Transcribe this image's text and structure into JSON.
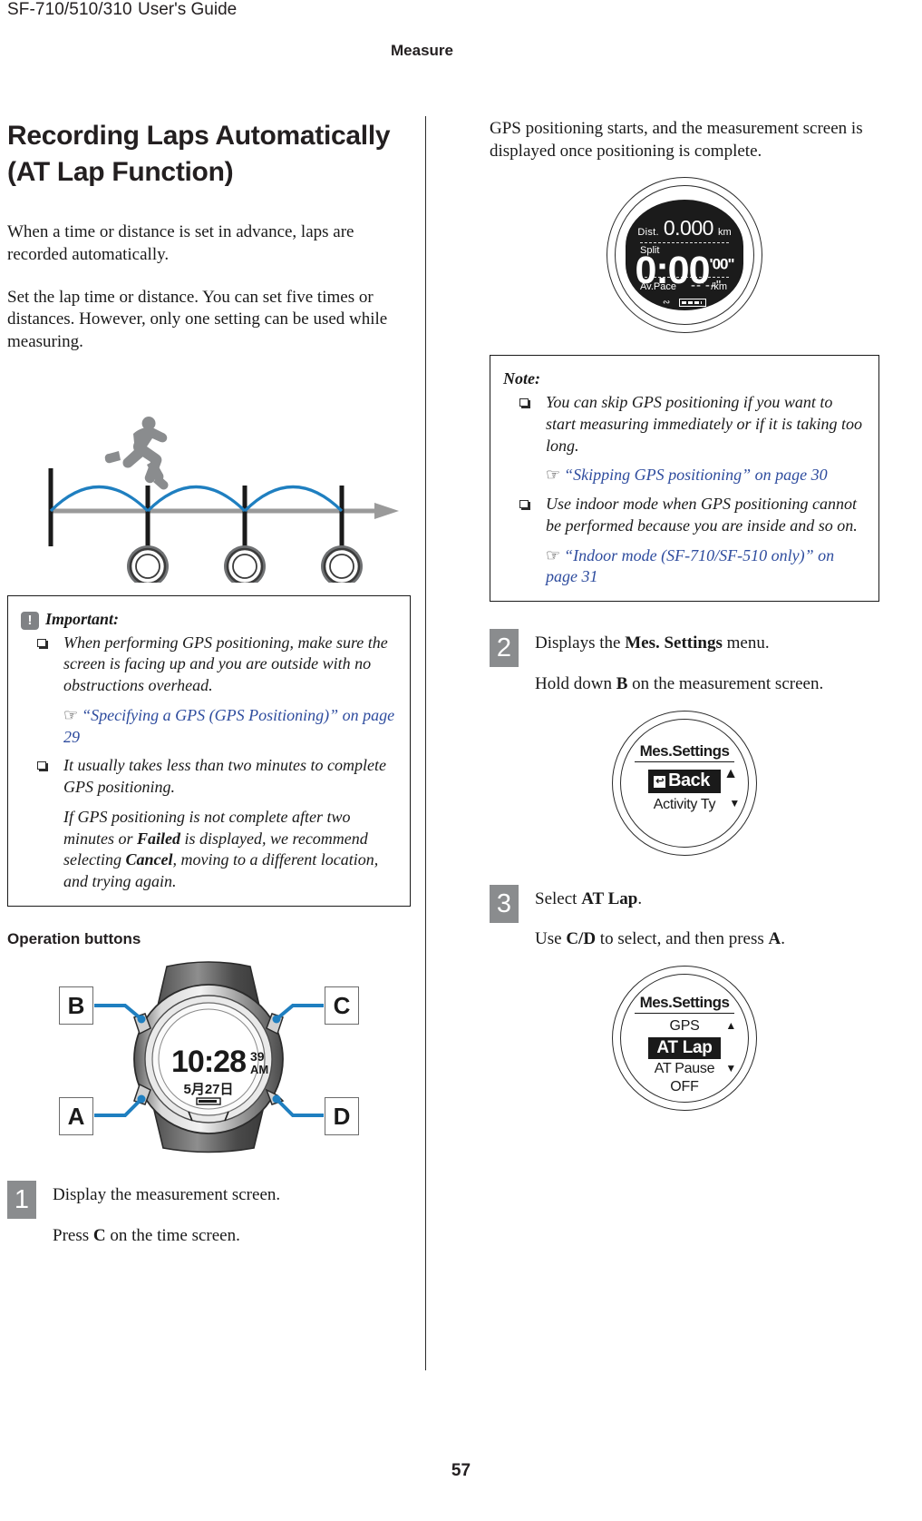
{
  "header": {
    "model": "SF-710/510/310",
    "guide": "User's Guide",
    "section": "Measure"
  },
  "left": {
    "title": "Recording Laps Automatically (AT Lap Function)",
    "intro1": "When a time or distance is set in advance, laps are recorded automatically.",
    "intro2": "Set the lap time or distance. You can set five times or distances. However, only one setting can be used while measuring.",
    "important": {
      "icon": "!",
      "label": "Important:",
      "items": [
        {
          "text": "When performing GPS positioning, make sure the screen is facing up and you are outside with no obstructions overhead.",
          "xref": "“Specifying a GPS (GPS Positioning)” on page 29",
          "xref_icon": "☞"
        },
        {
          "text": "It usually takes less than two minutes to complete GPS positioning.",
          "extra_pre": "If GPS positioning is not complete after two minutes or ",
          "extra_b1": "Failed",
          "extra_mid": " is displayed, we recommend selecting ",
          "extra_b2": "Cancel",
          "extra_post": ", moving to a different location, and trying again."
        }
      ]
    },
    "operation_buttons_heading": "Operation buttons",
    "watch_face": {
      "time": "10:28",
      "seconds": "39",
      "ampm": "AM",
      "date": "5月27日"
    },
    "button_callouts": [
      "B",
      "C",
      "A",
      "D"
    ],
    "step1": {
      "number": "1",
      "line1": "Display the measurement screen.",
      "line2_pre": "Press ",
      "line2_b": "C",
      "line2_post": " on the time screen."
    }
  },
  "right": {
    "intro": "GPS positioning starts, and the measurement screen is displayed once positioning is complete.",
    "measure_screen": {
      "dist_label": "Dist.",
      "dist_value": "0.000",
      "dist_unit": "km",
      "split_label": "Split",
      "split_value": "0:00",
      "split_seconds": "'00\"",
      "pace_label": "Av.Pace",
      "pace_value": "--'--\"",
      "pace_unit": "/km"
    },
    "note": {
      "label": "Note:",
      "items": [
        {
          "text": "You can skip GPS positioning if you want to start measuring immediately or if it is taking too long.",
          "xref": "“Skipping GPS positioning” on page 30",
          "xref_icon": "☞"
        },
        {
          "text": "Use indoor mode when GPS positioning cannot be performed because you are inside and so on.",
          "xref": "“Indoor mode (SF-710/SF-510 only)” on page 31",
          "xref_icon": "☞"
        }
      ]
    },
    "step2": {
      "number": "2",
      "line1_pre": "Displays the ",
      "line1_b": "Mes. Settings",
      "line1_post": " menu.",
      "line2_pre": "Hold down ",
      "line2_b": "B",
      "line2_post": " on the measurement screen."
    },
    "menu_screen_1": {
      "title": "Mes.Settings",
      "selected": "Back",
      "selected_icon": "↩",
      "next_item": "Activity Ty",
      "caret_up": "▲",
      "caret_down": "▼"
    },
    "step3": {
      "number": "3",
      "line1_pre": "Select ",
      "line1_b": "AT Lap",
      "line1_post": ".",
      "line2_pre": "Use ",
      "line2_b1": "C/D",
      "line2_mid": " to select, and then press ",
      "line2_b2": "A",
      "line2_post": "."
    },
    "menu_screen_2": {
      "title": "Mes.Settings",
      "item_above": "GPS",
      "selected": "AT Lap",
      "item_below": "AT Pause",
      "item_bottom": "OFF",
      "caret_up": "▲",
      "caret_down": "▼"
    }
  },
  "footer": {
    "page_number": "57"
  },
  "colors": {
    "link": "#2e4c9e",
    "accent_blue": "#1f7fc0",
    "gray": "#8a8c8e",
    "lcd_bg": "#1b1b1b"
  }
}
